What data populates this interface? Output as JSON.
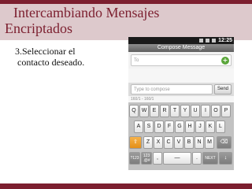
{
  "slide": {
    "title_line1": "Intercambiando Mensajes",
    "title_line2": "Encriptados",
    "bullet_line1": "3.Seleccionar el",
    "bullet_line2": "contacto deseado."
  },
  "phone": {
    "status_time": "12:25",
    "header_title": "Compose Message",
    "to_placeholder": "To",
    "add_contact_symbol": "+",
    "compose_placeholder": "Type to compose",
    "send_label": "Send",
    "char_count": "160/1 - 160/1"
  },
  "keyboard": {
    "row1": [
      "Q",
      "W",
      "E",
      "R",
      "T",
      "Y",
      "U",
      "I",
      "O",
      "P"
    ],
    "row2": [
      "A",
      "S",
      "D",
      "F",
      "G",
      "H",
      "J",
      "K",
      "L"
    ],
    "row3_letters": [
      "Z",
      "X",
      "C",
      "V",
      "B",
      "N",
      "M"
    ],
    "shift_symbol": "⇧",
    "delete_symbol": "⌫",
    "symbols_key": "?123",
    "numbers_key": "123\n.@#",
    "comma_key": ",",
    "space_symbol": "—",
    "period_key": ".",
    "next_label": "NEXT",
    "enter_symbol": "↓"
  },
  "colors": {
    "accent": "#7c1f2f",
    "band": "#ddc9cc",
    "shift_key": "#e38f18",
    "add_contact": "#5aa63a"
  }
}
